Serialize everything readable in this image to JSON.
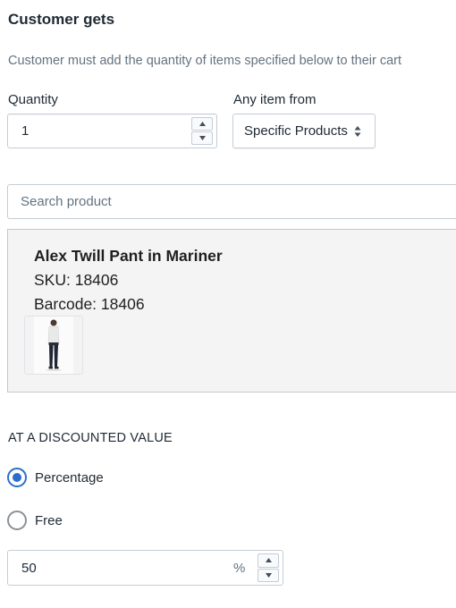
{
  "section": {
    "title": "Customer gets",
    "subtitle": "Customer must add the quantity of items specified below to their cart"
  },
  "quantity": {
    "label": "Quantity",
    "value": "1"
  },
  "any_item": {
    "label": "Any item from",
    "selected": "Specific Products"
  },
  "search": {
    "placeholder": "Search product"
  },
  "product": {
    "name": "Alex Twill Pant in Mariner",
    "sku": "SKU: 18406",
    "barcode": "Barcode: 18406"
  },
  "discount": {
    "title": "AT A DISCOUNTED VALUE",
    "options": [
      "Percentage",
      "Free"
    ],
    "selected": "Percentage",
    "value": "50",
    "suffix": "%"
  },
  "colors": {
    "radio_selected": "#2c6ecb",
    "card_background": "#f4f4f4"
  }
}
